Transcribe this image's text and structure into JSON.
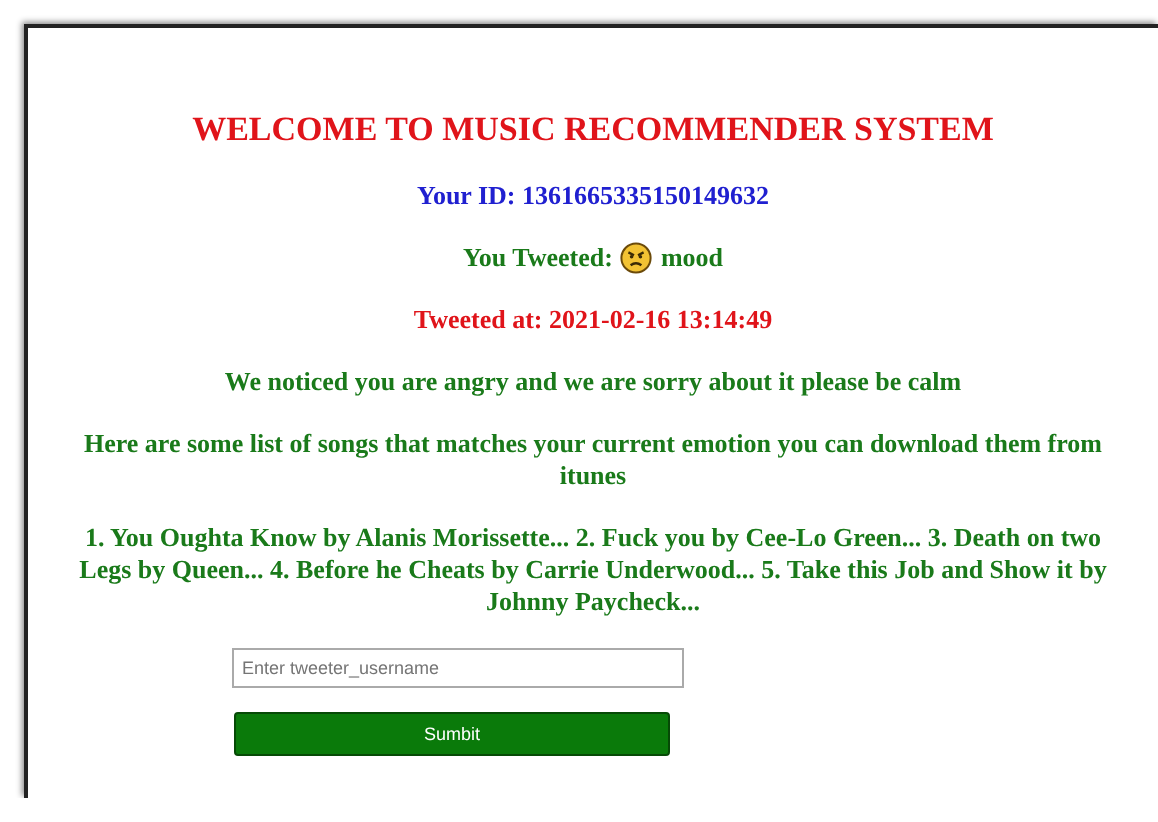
{
  "title": "WELCOME TO MUSIC RECOMMENDER SYSTEM",
  "user_id": "Your ID: 1361665335150149632",
  "tweet": {
    "label": "You Tweeted:",
    "text": "mood"
  },
  "tweeted_at": "Tweeted at: 2021-02-16 13:14:49",
  "notice": "We noticed you are angry and we are sorry about it please be calm",
  "intro": "Here are some list of songs that matches your current emotion you can download them from itunes",
  "songs": "1. You Oughta Know by Alanis Morissette... 2. Fuck you by Cee-Lo Green... 3. Death on two Legs by Queen... 4. Before he Cheats by Carrie Underwood... 5. Take this Job and Show it by Johnny Paycheck...",
  "form": {
    "placeholder": "Enter tweeter_username",
    "button": "Sumbit"
  }
}
